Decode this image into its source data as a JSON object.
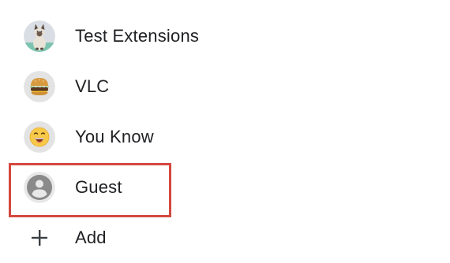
{
  "profiles": [
    {
      "label": "Test Extensions",
      "avatar": "cat-avatar-icon"
    },
    {
      "label": "VLC",
      "avatar": "burger-avatar-icon"
    },
    {
      "label": "You Know",
      "avatar": "laughing-face-avatar-icon"
    },
    {
      "label": "Guest",
      "avatar": "person-avatar-icon"
    }
  ],
  "add": {
    "label": "Add",
    "icon": "plus-icon"
  },
  "colors": {
    "highlight_border": "#d4493f",
    "text": "#202124",
    "guest_icon": "#8a8a8a"
  }
}
